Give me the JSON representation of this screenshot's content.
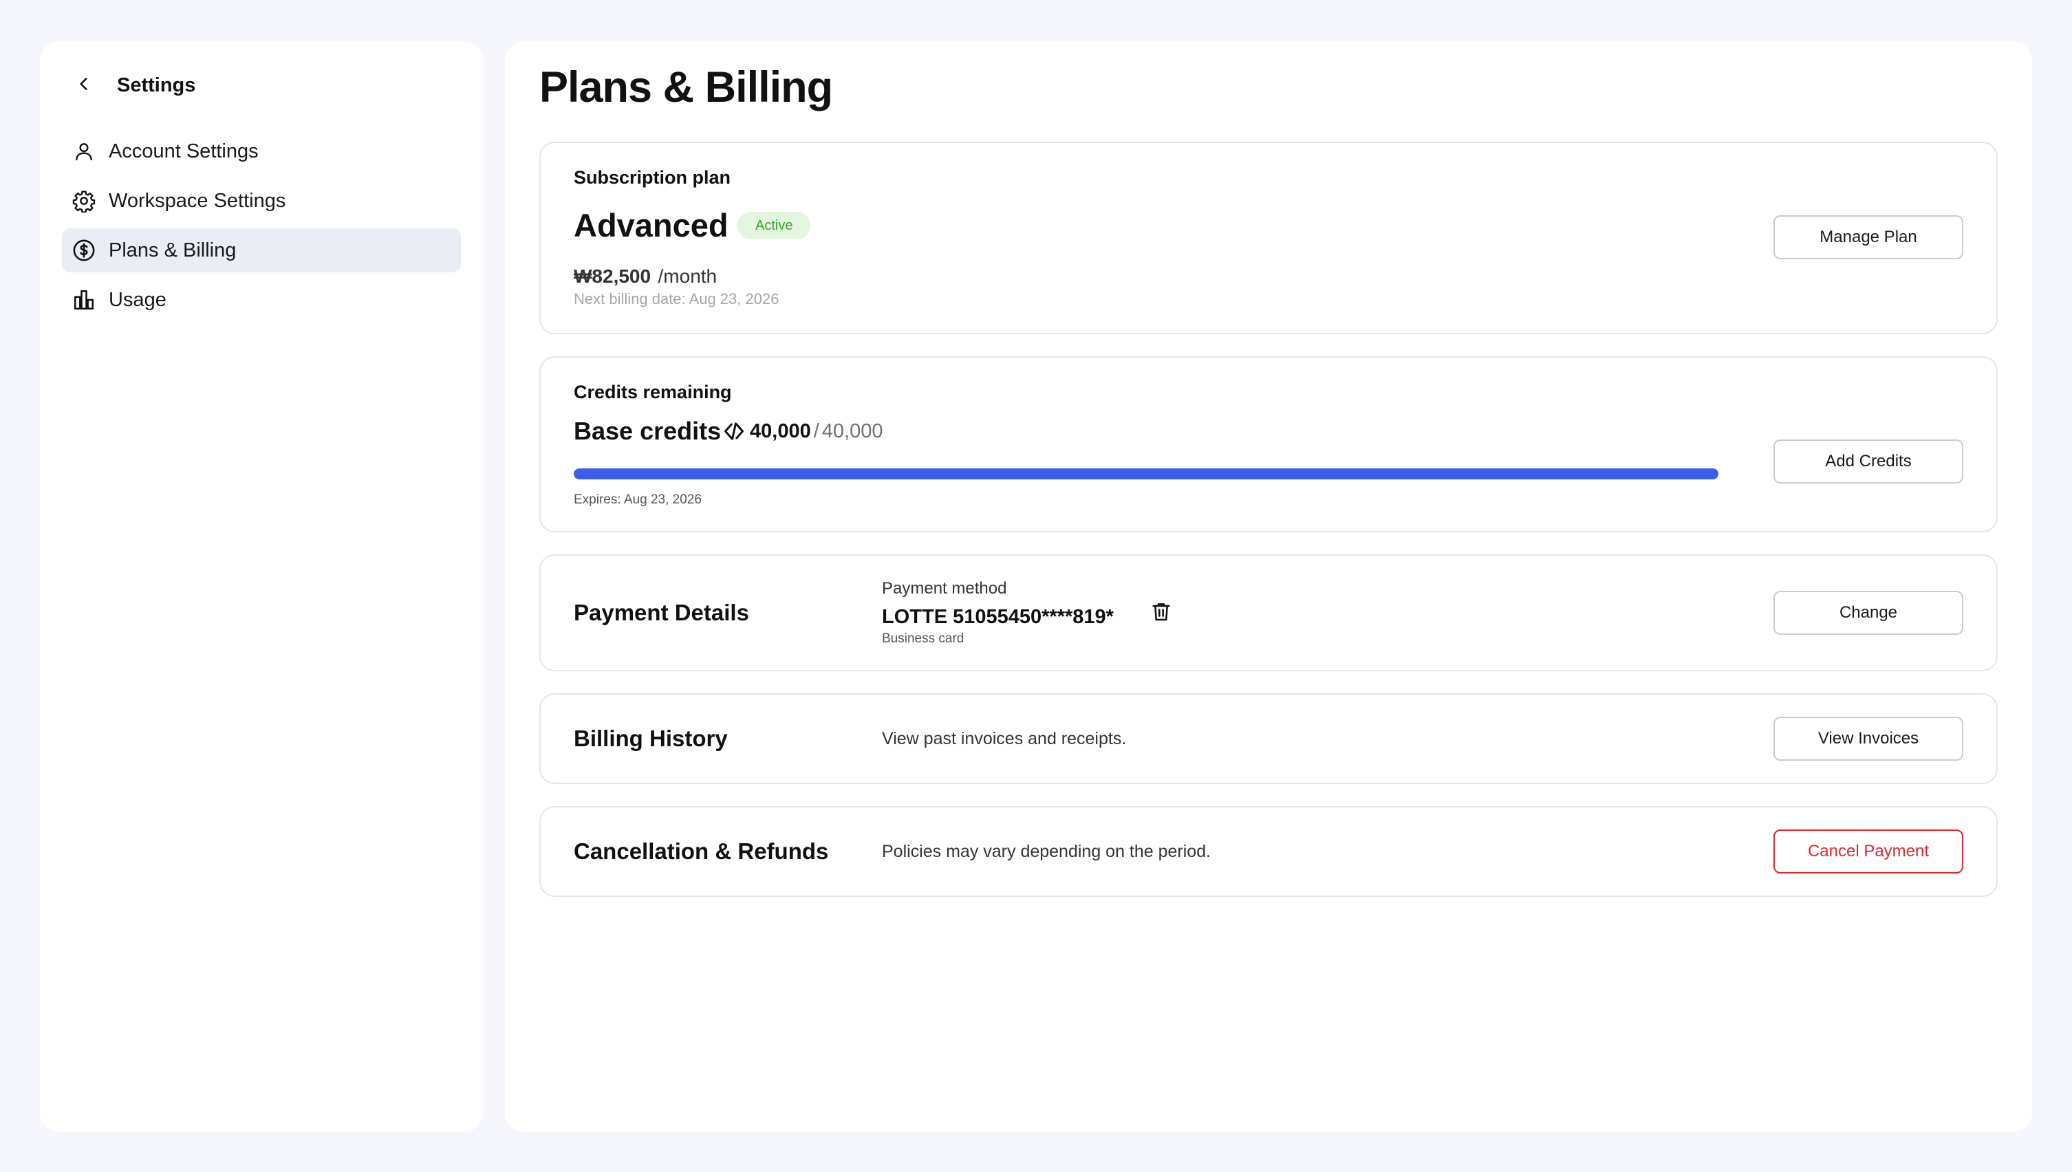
{
  "sidebar": {
    "title": "Settings",
    "back_icon": "chevron-left-icon",
    "items": [
      {
        "label": "Account Settings",
        "icon": "user-icon",
        "active": false
      },
      {
        "label": "Workspace Settings",
        "icon": "gear-icon",
        "active": false
      },
      {
        "label": "Plans & Billing",
        "icon": "dollar-circle-icon",
        "active": true
      },
      {
        "label": "Usage",
        "icon": "bar-chart-icon",
        "active": false
      }
    ]
  },
  "main": {
    "title": "Plans & Billing",
    "subscription": {
      "label": "Subscription plan",
      "plan_name": "Advanced",
      "status": "Active",
      "price": "₩82,500",
      "period": "/month",
      "next_billing": "Next billing date: Aug 23, 2026",
      "button": "Manage Plan"
    },
    "credits": {
      "label": "Credits remaining",
      "title": "Base credits",
      "remaining": "40,000",
      "separator": "/",
      "total": "40,000",
      "progress_percent": 100,
      "expires": "Expires: Aug 23, 2026",
      "button": "Add Credits"
    },
    "payment": {
      "title": "Payment Details",
      "method_label": "Payment method",
      "card": "LOTTE 51055450****819*",
      "card_type": "Business card",
      "button": "Change"
    },
    "billing_history": {
      "title": "Billing History",
      "description": "View past invoices and receipts.",
      "button": "View Invoices"
    },
    "cancellation": {
      "title": "Cancellation & Refunds",
      "description": "Policies may vary depending on the period.",
      "button": "Cancel Payment"
    }
  },
  "colors": {
    "accent": "#3c5de8",
    "danger": "#e5242c",
    "badge_bg": "#e3f6de",
    "badge_text": "#3ea32f",
    "page_bg": "#f6f7fc"
  }
}
